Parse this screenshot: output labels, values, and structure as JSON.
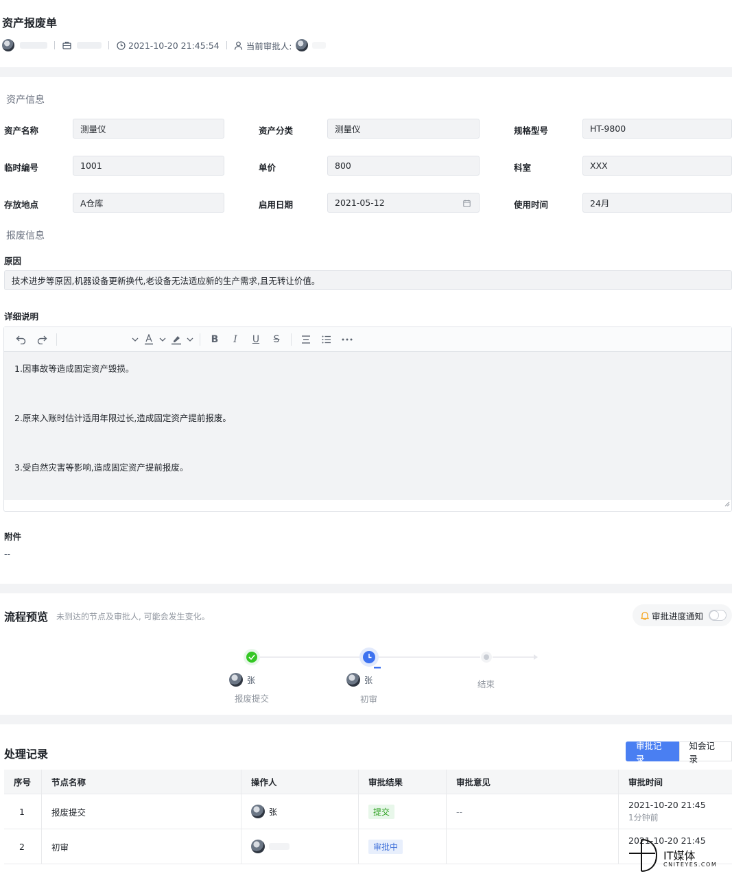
{
  "header": {
    "title": "资产报废单",
    "datetime": "2021-10-20 21:45:54",
    "current_approver_label": "当前审批人:"
  },
  "asset_section": {
    "title": "资产信息",
    "fields": {
      "name": {
        "label": "资产名称",
        "value": "测量仪"
      },
      "category": {
        "label": "资产分类",
        "value": "测量仪"
      },
      "model": {
        "label": "规格型号",
        "value": "HT-9800"
      },
      "temp_no": {
        "label": "临时编号",
        "value": "1001"
      },
      "price": {
        "label": "单价",
        "value": "800"
      },
      "dept": {
        "label": "科室",
        "value": "XXX"
      },
      "location": {
        "label": "存放地点",
        "value": "A仓库"
      },
      "start_date": {
        "label": "启用日期",
        "value": "2021-05-12"
      },
      "usage_time": {
        "label": "使用时间",
        "value": "24月"
      }
    }
  },
  "scrap_section": {
    "title": "报废信息",
    "reason_label": "原因",
    "reason_value": "技术进步等原因,机器设备更新换代,老设备无法适应新的生产需求,且无转让价值。",
    "detail_label": "详细说明",
    "detail_lines": [
      "1.因事故等造成固定资产毁损。",
      "2.原来入账时估计适用年限过长,造成固定资产提前报废。",
      "3.受自然灾害等影响,造成固定资产提前报废。"
    ],
    "attachment_label": "附件",
    "attachment_value": "--"
  },
  "flow": {
    "title": "流程预览",
    "hint": "未到达的节点及审批人, 可能会发生变化。",
    "notify_label": "审批进度通知",
    "nodes": [
      {
        "label": "报废提交",
        "person": "张",
        "status": "done"
      },
      {
        "label": "初审",
        "person": "张",
        "status": "current"
      },
      {
        "label": "结束",
        "person": "",
        "status": "pending"
      }
    ]
  },
  "records": {
    "title": "处理记录",
    "tabs": [
      "审批记录",
      "知会记录"
    ],
    "columns": [
      "序号",
      "节点名称",
      "操作人",
      "审批结果",
      "审批意见",
      "审批时间"
    ],
    "rows": [
      {
        "no": "1",
        "node": "报废提交",
        "operator": "张",
        "result": "提交",
        "opinion": "--",
        "time": "2021-10-20 21:45",
        "ago": "1分钟前"
      },
      {
        "no": "2",
        "node": "初审",
        "operator": "",
        "result": "审批中",
        "opinion": "",
        "time": "2021-10-20 21:45",
        "ago": ""
      }
    ]
  },
  "watermark": {
    "brand": "IT媒体",
    "site": "CNITEYES.COM"
  },
  "colors": {
    "primary": "#4a7ff2",
    "success": "#2ea121",
    "bg_gap": "#f2f3f5"
  }
}
